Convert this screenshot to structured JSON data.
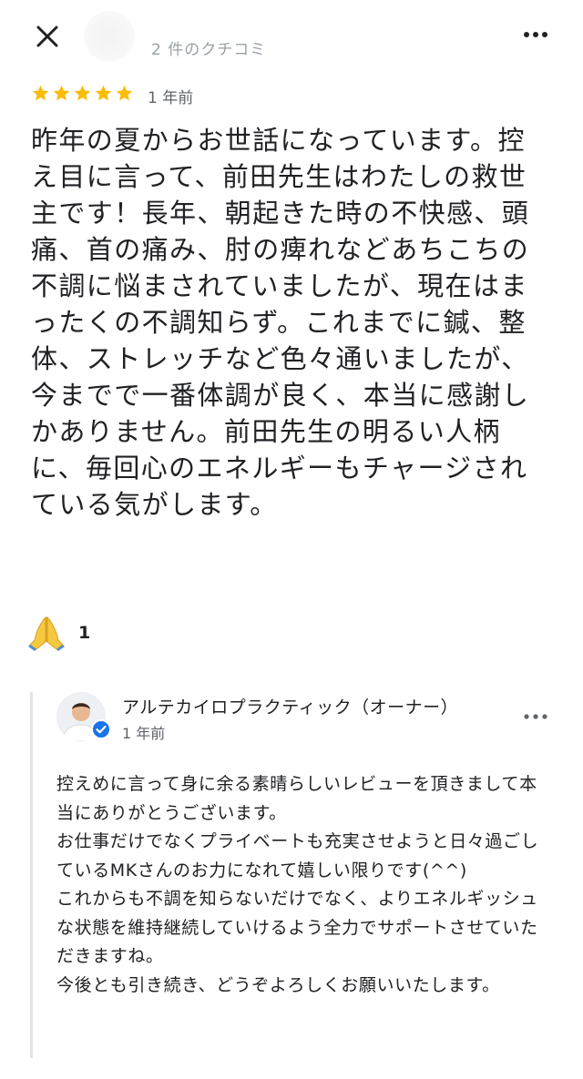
{
  "header": {
    "close_icon": "close-icon",
    "reviewer_review_count": "2 件のクチコミ",
    "more_icon": "more-horiz-icon"
  },
  "review": {
    "rating": 5,
    "rating_max": 5,
    "star_color": "#fbbc04",
    "age": "1 年前",
    "text": "昨年の夏からお世話になっています。控え目に言って、前田先生はわたしの救世主です！長年、朝起きた時の不快感、頭痛、首の痛み、肘の痺れなどあちこちの不調に悩まされていましたが、現在はまったくの不調知らず。これまでに鍼、整体、ストレッチなど色々通いましたが、今までで一番体調が良く、本当に感謝しかありません。前田先生の明るい人柄に、毎回心のエネルギーもチャージされている気がします。",
    "reaction": {
      "icon": "folded-hands-icon",
      "count": "1"
    }
  },
  "owner_response": {
    "name": "アルテカイロプラクティック（オーナー）",
    "age": "1 年前",
    "verified_icon": "verified-check-icon",
    "verified_color": "#1a73e8",
    "more_icon": "more-horiz-icon",
    "text": "控えめに言って身に余る素晴らしいレビューを頂きまして本当にありがとうございます。\nお仕事だけでなくプライベートも充実させようと日々過ごしているMKさんのお力になれて嬉しい限りです(^^)\nこれからも不調を知らないだけでなく、よりエネルギッシュな状態を維持継続していけるよう全力でサポートさせていただきますね。\n今後とも引き続き、どうぞよろしくお願いいたします。"
  }
}
